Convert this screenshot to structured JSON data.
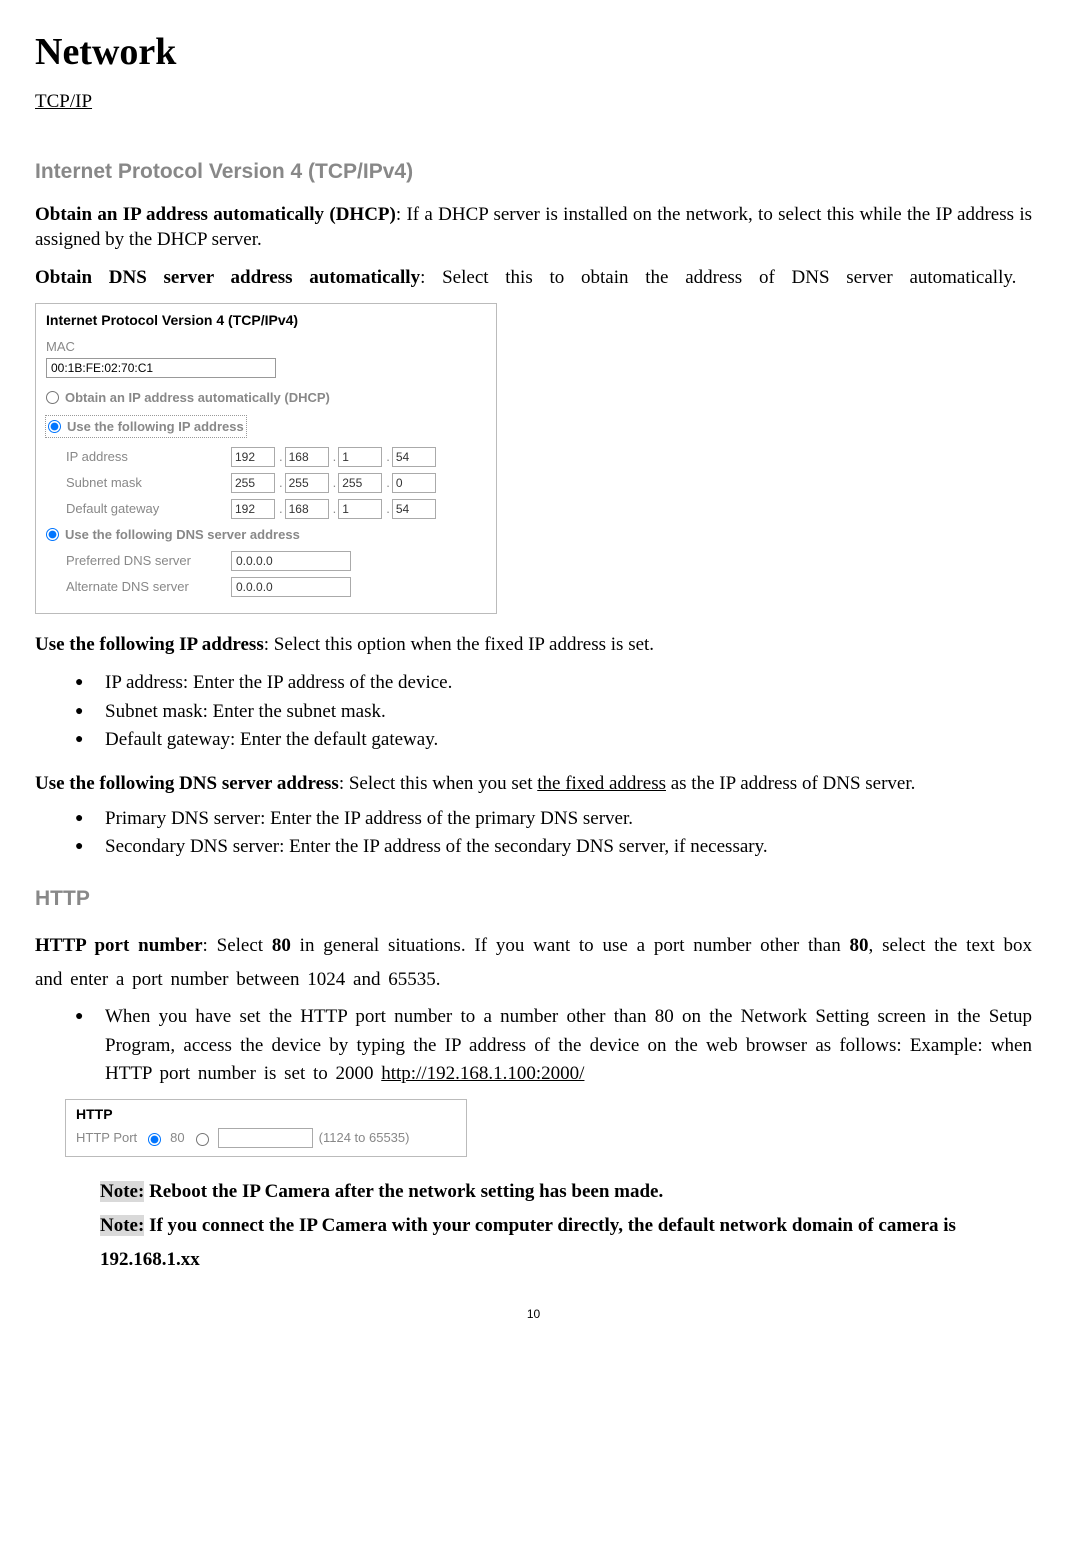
{
  "title": "Network",
  "tcpip_link": "TCP/IP",
  "h_ipv4": "Internet Protocol Version 4 (TCP/IPv4)",
  "p1_bold": "Obtain an IP address automatically (DHCP)",
  "p1_rest": ": If a DHCP server is installed on the network, to select this while the IP address is assigned by the DHCP server.",
  "p2_bold": "Obtain DNS server address automatically",
  "p2_rest": ": Select this to obtain the address of DNS server automatically.",
  "ipv4": {
    "panel_title": "Internet Protocol Version 4 (TCP/IPv4)",
    "mac_label": "MAC",
    "mac_value": "00:1B:FE:02:70:C1",
    "radio_dhcp": "Obtain an IP address automatically (DHCP)",
    "radio_static": "Use the following IP address",
    "ip_label": "IP address",
    "ip": [
      "192",
      "168",
      "1",
      "54"
    ],
    "mask_label": "Subnet mask",
    "mask": [
      "255",
      "255",
      "255",
      "0"
    ],
    "gw_label": "Default gateway",
    "gw": [
      "192",
      "168",
      "1",
      "54"
    ],
    "radio_dns": "Use the following DNS server address",
    "pref_dns_label": "Preferred DNS server",
    "pref_dns_value": "0.0.0.0",
    "alt_dns_label": "Alternate DNS server",
    "alt_dns_value": "0.0.0.0"
  },
  "p3_bold": "Use the following IP address",
  "p3_rest": ": Select this option when the fixed IP address is set.",
  "bullets1": {
    "b1": "IP address: Enter the IP address of the device.",
    "b2": "Subnet mask: Enter the subnet mask.",
    "b3": "Default gateway: Enter the default gateway."
  },
  "p4_bold": "Use the following DNS server address",
  "p4_a": ": Select this when you set ",
  "p4_u": "the fixed address",
  "p4_b": " as the IP address of DNS server.",
  "bullets2": {
    "b1": "Primary DNS server: Enter the IP address of the primary DNS server.",
    "b2": "Secondary DNS server: Enter the IP address of the secondary DNS server, if necessary."
  },
  "h_http": "HTTP",
  "http_p1_a": "HTTP port number",
  "http_p1_b": ": Select ",
  "http_p1_c": "80",
  "http_p1_d": " in general situations. If you want to use a port number other than ",
  "http_p1_e": "80",
  "http_p1_f": ", select the text box and enter a port number between 1024 and 65535.",
  "http_bullet_a": "When you have set the HTTP port number to a number other than 80 on the Network Setting screen in the Setup Program, access the device by typing the IP address of the device on the web browser as follows: Example: when HTTP port number is set to 2000 ",
  "http_bullet_link": "http://192.168.1.100:2000/",
  "http_panel": {
    "title": "HTTP",
    "port_label": "HTTP Port",
    "port_default": "80",
    "range_hint": "(1124 to 65535)"
  },
  "note_prefix": "Note:",
  "note1_rest": " Reboot the IP Camera after the network setting has been made",
  "note2_rest": " If you connect the IP Camera with your computer directly, the default network domain of camera is 192.168.1.xx",
  "page_number": "10"
}
